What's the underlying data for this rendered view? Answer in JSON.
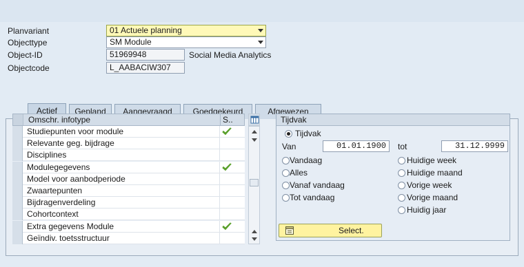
{
  "header": {
    "planvariant": {
      "label": "Planvariant",
      "value": "01 Actuele planning"
    },
    "objecttype": {
      "label": "Objecttype",
      "value": "SM Module"
    },
    "object_id": {
      "label": "Object-ID",
      "value": "51969948",
      "description": "Social Media Analytics"
    },
    "objectcode": {
      "label": "Objectcode",
      "value": "L_AABACIW307"
    }
  },
  "tabs": [
    {
      "label": "Actief",
      "active": true
    },
    {
      "label": "Gepland"
    },
    {
      "label": "Aangevraagd"
    },
    {
      "label": "Goedgekeurd"
    },
    {
      "label": "Afgewezen"
    }
  ],
  "table": {
    "columns": [
      "Omschr. infotype",
      "S.."
    ],
    "rows": [
      {
        "name": "Studiepunten voor module",
        "status": true
      },
      {
        "name": "Relevante geg. bijdrage",
        "status": false
      },
      {
        "name": "Disciplines",
        "status": false
      },
      {
        "name": "Modulegegevens",
        "status": true
      },
      {
        "name": "Model voor aanbodperiode",
        "status": false
      },
      {
        "name": "Zwaartepunten",
        "status": false
      },
      {
        "name": "Bijdragenverdeling",
        "status": false
      },
      {
        "name": "Cohortcontext",
        "status": false
      },
      {
        "name": "Extra gegevens Module",
        "status": true
      },
      {
        "name": "Geïndiv. toetsstructuur",
        "status": false
      }
    ]
  },
  "tijdvak": {
    "title": "Tijdvak",
    "radio_tijdvak": "Tijdvak",
    "van_label": "Van",
    "van_value": "01.01.1900",
    "tot_label": "tot",
    "tot_value": "31.12.9999",
    "left_options": [
      "Vandaag",
      "Alles",
      "Vanaf vandaag",
      "Tot vandaag"
    ],
    "right_options": [
      "Huidige week",
      "Huidige maand",
      "Vorige week",
      "Vorige maand",
      "Huidig jaar"
    ],
    "selected": "Tijdvak"
  },
  "select_button": {
    "label": "Select."
  },
  "colors": {
    "check": "#5aa02c",
    "accent_yellow": "#fff9b8"
  }
}
